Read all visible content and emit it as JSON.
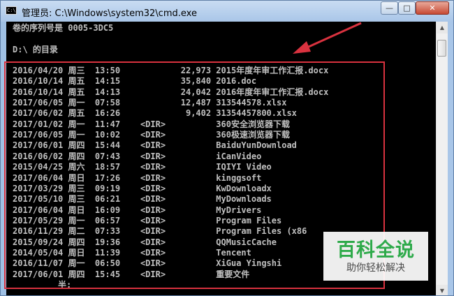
{
  "window": {
    "title": "管理员: C:\\Windows\\system32\\cmd.exe",
    "icon": "C:\\",
    "controls": {
      "minimize": "—",
      "maximize": "□",
      "close": "✕"
    }
  },
  "console": {
    "volume_serial": "卷的序列号是 0005-3DC5",
    "directory_header": "D:\\ 的目录",
    "entries": [
      "2016/04/20 周三  13:50            22,973 2015年度年审工作汇报.docx",
      "2016/10/14 周五  14:15            35,840 2016.doc",
      "2016/10/14 周五  14:13            24,042 2016年度年审工作汇报.docx",
      "2017/06/05 周一  07:58            12,487 313544578.xlsx",
      "2017/06/02 周五  16:26             9,402 31354457800.xlsx",
      "2017/01/02 周一  11:47    <DIR>          360安全浏览器下载",
      "2017/06/05 周一  10:02    <DIR>          360极速浏览器下载",
      "2017/06/01 周四  15:44    <DIR>          BaiduYunDownload",
      "2016/06/02 周四  07:43    <DIR>          iCanVideo",
      "2015/04/25 周六  18:57    <DIR>          IQIYI Video",
      "2017/06/04 周日  17:26    <DIR>          kinggsoft",
      "2017/03/29 周三  09:19    <DIR>          KwDownloadx",
      "2017/05/10 周三  06:21    <DIR>          MyDownloads",
      "2017/06/04 周日  16:09    <DIR>          MyDrivers",
      "2017/05/29 周一  06:57    <DIR>          Program Files",
      "2016/11/29 周二  07:33    <DIR>          Program Files (x86",
      "2015/09/24 周四  19:36    <DIR>          QQMusicCache",
      "2014/05/04 周日  11:39    <DIR>          Tencent",
      "2016/11/07 周一  06:50    <DIR>          XiGua Yingshi",
      "2017/06/01 周四  15:45    <DIR>          重要文件"
    ],
    "partial_line": "         半:"
  },
  "scrollbar": {
    "up": "▲",
    "down": "▼"
  },
  "watermark": {
    "title": "百科全说",
    "subtitle": "助你轻松解决"
  },
  "colors": {
    "console_bg": "#000000",
    "console_text": "#c0c0c0",
    "highlight": "#d9323f",
    "watermark_green": "#2eaa4a"
  }
}
